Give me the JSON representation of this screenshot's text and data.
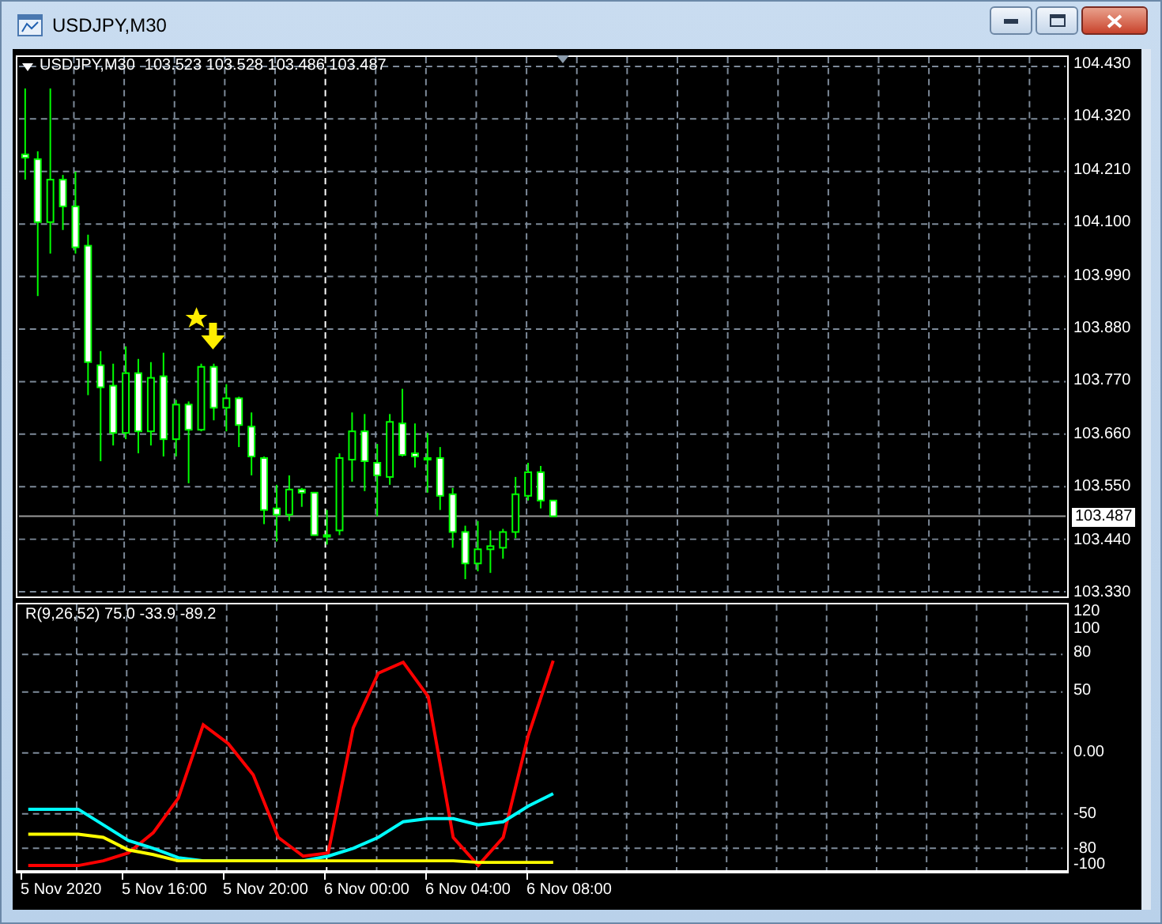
{
  "window": {
    "title": "USDJPY,M30"
  },
  "price_chart": {
    "symbol": "USDJPY,M30",
    "ohlc": "103.523 103.528 103.486 103.487",
    "yticks": [
      "104.430",
      "104.320",
      "104.210",
      "104.100",
      "103.990",
      "103.880",
      "103.770",
      "103.660",
      "103.550",
      "103.440",
      "103.330"
    ],
    "current_price": "103.487"
  },
  "indicator": {
    "label": "R(9,26,52) 75.0 -33.9 -89.2",
    "yticks": [
      "120",
      "100",
      "80",
      "50",
      "0.00",
      "-50",
      "-80",
      "-100"
    ]
  },
  "time_axis": [
    "5 Nov 2020",
    "5 Nov 16:00",
    "5 Nov 20:00",
    "6 Nov 00:00",
    "6 Nov 04:00",
    "6 Nov 08:00"
  ]
}
